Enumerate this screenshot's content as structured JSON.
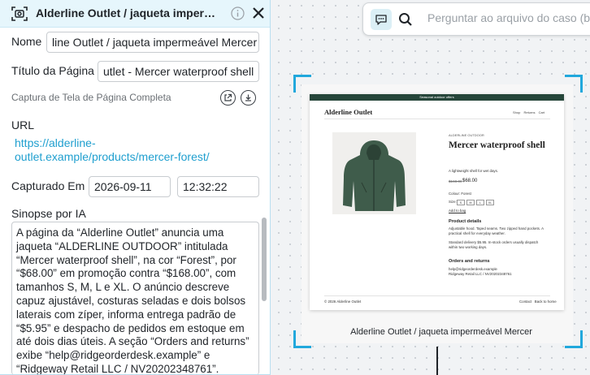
{
  "panel": {
    "title": "Alderline Outlet / jaqueta impermeá...",
    "fields": {
      "name_label": "Nome",
      "name_value": "line Outlet / jaqueta impermeável Mercer",
      "page_title_label": "Título da Página",
      "page_title_value": "utlet - Mercer waterproof shell",
      "capture_type": "Captura de Tela de Página Completa",
      "url_label": "URL",
      "url_value": "https://alderline-outlet.example/products/mercer-forest/",
      "captured_label": "Capturado Em",
      "captured_date": "2026-09-11",
      "captured_time": "12:32:22",
      "synopsis_label": "Sinopse por IA",
      "synopsis_text": "A página da “Alderline Outlet” anuncia uma jaqueta “ALDERLINE OUTDOOR” intitulada “Mercer waterproof shell”, na cor “Forest”, por “$68.00” em promoção contra “$168.00”, com tamanhos S, M, L e XL. O anúncio descreve capuz ajustável, costuras seladas e dois bolsos laterais com zíper, informa entrega padrão de “$5.95” e despacho de pedidos em estoque em até dois dias úteis. A seção “Orders and returns” exibe “help@ridgeorderdesk.example” e “Ridgeway Retail LLC / NV20202348761”."
    }
  },
  "search": {
    "placeholder": "Perguntar ao arquivo do caso (be"
  },
  "preview": {
    "caption": "Alderline Outlet / jaqueta impermeável Mercer",
    "page": {
      "banner": "Seasonal outdoor offers",
      "brand": "Alderline Outlet",
      "nav": "Shop Returns Cart",
      "tag": "ALDERLINE OUTDOOR",
      "title": "Mercer waterproof shell",
      "subtitle": "A lightweight shell for wet days.",
      "price_old": "$168.00",
      "price": "$68.00",
      "colour": "Colour: Forest",
      "size_label": "Size:",
      "sizes": [
        "S",
        "M",
        "L",
        "XL"
      ],
      "add_to_bag": "Add to bag",
      "details_heading": "Product details",
      "details_1": "Adjustable hood. Taped seams. Two zipped hand pockets. A practical shell for everyday weather.",
      "details_2": "Standard delivery $5.95. In-stock orders usually dispatch within two working days.",
      "orders_heading": "Orders and returns",
      "orders_1": "help@ridgeorderdesk.example",
      "orders_2": "Ridgeway Retail LLC / NV20202348761",
      "footer_left": "© 2026 Alderline Outlet",
      "footer_right": "Contact   Back to home"
    }
  },
  "colors": {
    "accent": "#21a8dc",
    "link": "#1f9fcf",
    "header_bg": "#e6f6fc",
    "jacket": "#3f5c4b"
  }
}
